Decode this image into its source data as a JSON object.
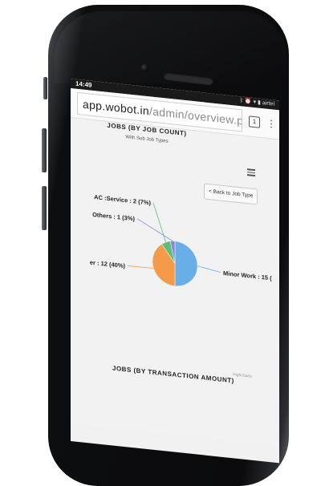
{
  "status_bar": {
    "time": "14:49",
    "icons_text": "ᛒ ⏰ ▾ ▮ airtel"
  },
  "browser": {
    "url_domain": "app.wobot.in",
    "url_path": "/admin/overview.php",
    "tab_count": "1",
    "menu_icon": "⋮"
  },
  "chart1": {
    "title": "JOBS (BY JOB COUNT)",
    "subtitle": "With Sub Job Types",
    "back_button": "Back to Job Type",
    "credits": "Highcharts"
  },
  "chart_data": {
    "type": "pie",
    "title": "JOBS (BY JOB COUNT)",
    "subtitle": "With Sub Job Types",
    "series": [
      {
        "name": "",
        "points": [
          {
            "label": "Minor Work : 15 (",
            "value": 15,
            "color": "#6aaee8"
          },
          {
            "label": "er : 12 (40%)",
            "value": 12,
            "color": "#f59a4a"
          },
          {
            "label": "AC :Service : 2 (7%)",
            "value": 2,
            "color": "#5bbf7a"
          },
          {
            "label": "Others : 1 (3%)",
            "value": 1,
            "color": "#8a86d6"
          }
        ]
      }
    ]
  },
  "chart2": {
    "title": "JOBS (BY TRANSACTION AMOUNT)"
  }
}
